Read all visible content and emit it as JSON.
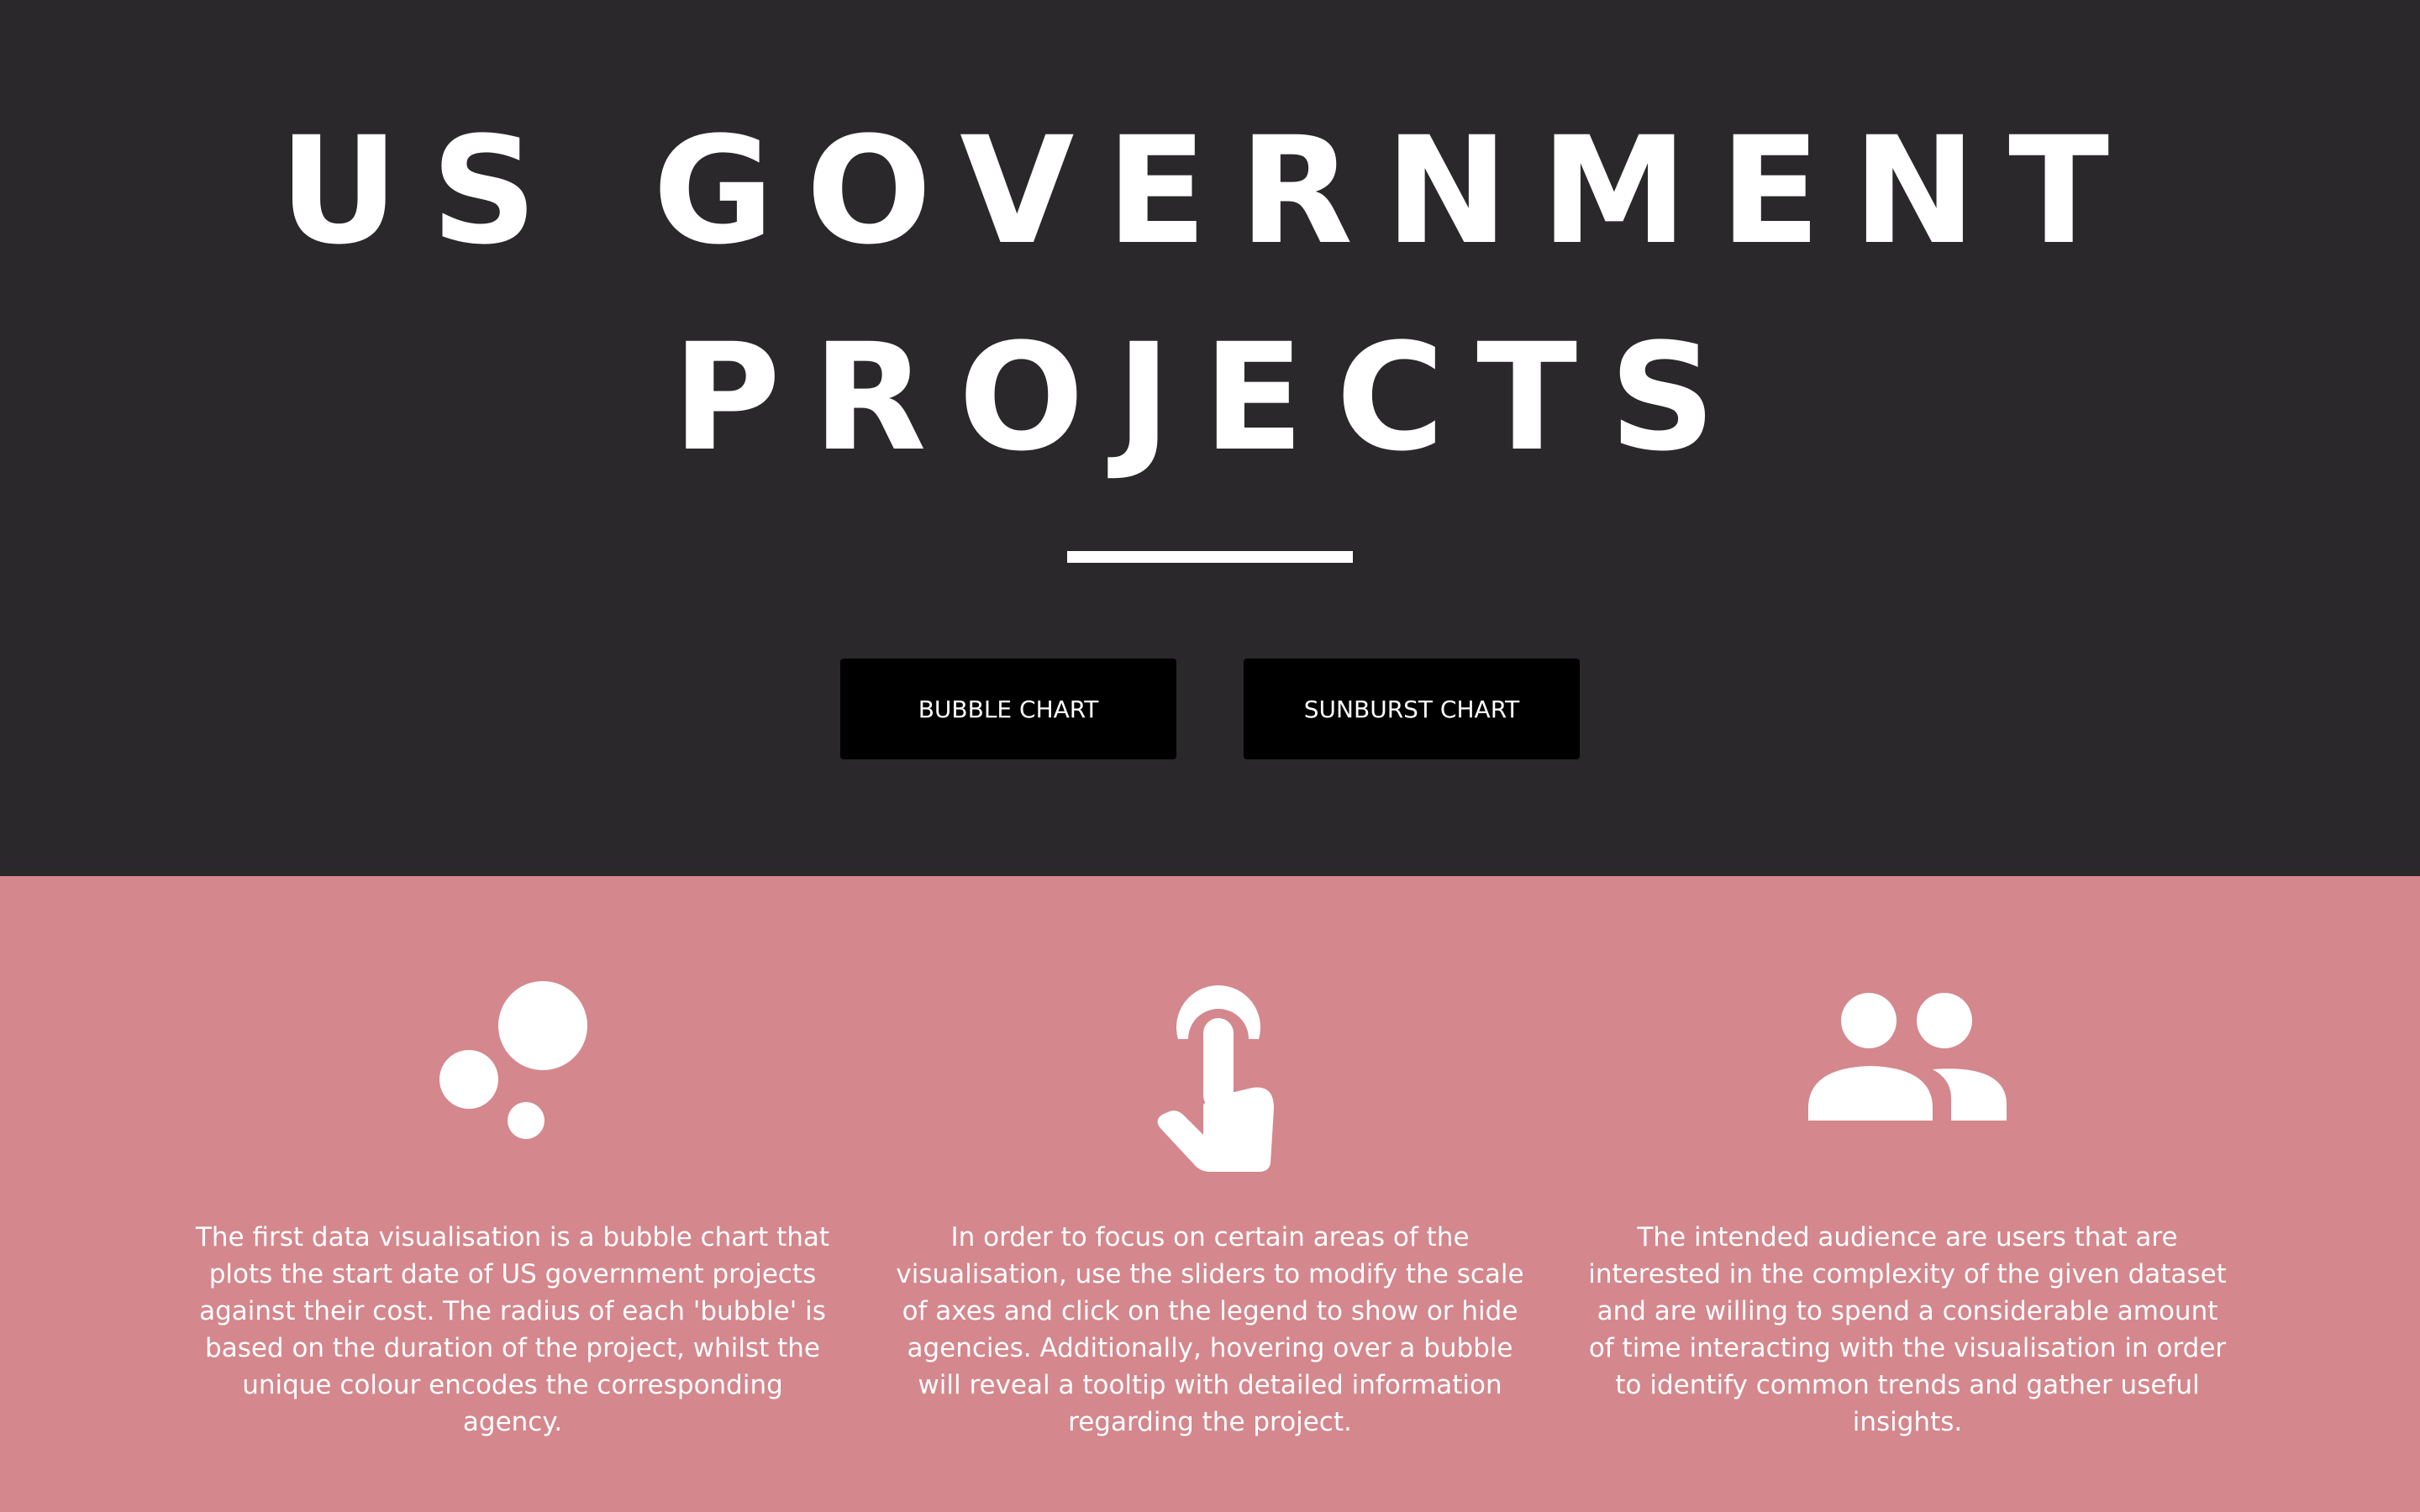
{
  "header": {
    "title_line1": "US GOVERNMENT",
    "title_line2": "PROJECTS",
    "background": "#2a282a"
  },
  "buttons": {
    "bubble_label": "BUBBLE CHART",
    "sunburst_label": "SUNBURST CHART"
  },
  "features": {
    "background": "#d4878d",
    "items": [
      {
        "icon": "bubbles-icon",
        "text": "The first data visualisation is a bubble chart that plots the start date of US government projects against their cost. The radius of each 'bubble' is based on the duration of the project, whilst the unique colour encodes the corresponding agency."
      },
      {
        "icon": "pointer-hand-icon",
        "text": "In order to focus on certain areas of the visualisation, use the sliders to modify the scale of axes and click on the legend to show or hide agencies. Additionally, hovering over a bubble will reveal a tooltip with detailed information regarding the project."
      },
      {
        "icon": "users-icon",
        "text": "The intended audience are users that are interested in the complexity of the given dataset and are willing to spend a considerable amount of time interacting with the visualisation in order to identify common trends and gather useful insights."
      }
    ]
  }
}
